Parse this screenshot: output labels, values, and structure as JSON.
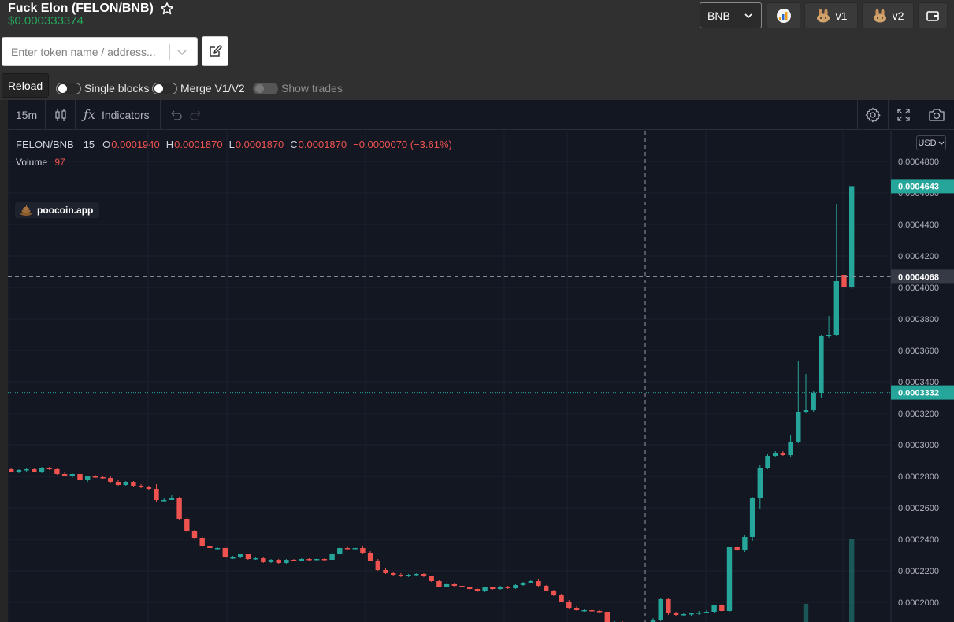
{
  "token": {
    "title": "Fuck Elon (FELON/BNB)",
    "price": "$0.000333374"
  },
  "search": {
    "placeholder": "Enter token name / address..."
  },
  "header": {
    "network": "BNB",
    "v1_label": "v1",
    "v2_label": "v2"
  },
  "controls": {
    "reload": "Reload",
    "single_blocks": "Single blocks",
    "merge": "Merge V1/V2",
    "show_trades": "Show trades"
  },
  "toolbar": {
    "interval": "15m",
    "indicators": "Indicators"
  },
  "legend": {
    "symbol": "FELON/BNB",
    "interval": "15",
    "o_label": "O",
    "o": "0.0001940",
    "h_label": "H",
    "h": "0.0001870",
    "l_label": "L",
    "l": "0.0001870",
    "c_label": "C",
    "c": "0.0001870",
    "change": "−0.0000070 (−3.61%)",
    "volume_label": "Volume",
    "volume": "97"
  },
  "watermark": "poocoin.app",
  "currency": "USD",
  "colors": {
    "up": "#26a69a",
    "down": "#ef5350",
    "bg": "#131722",
    "price_green": "#26a65b"
  },
  "chart_data": {
    "type": "candlestick",
    "y_ticks": [
      "0.0004800",
      "0.0004600",
      "0.0004400",
      "0.0004200",
      "0.0004000",
      "0.0003800",
      "0.0003600",
      "0.0003400",
      "0.0003200",
      "0.0003000",
      "0.0002800",
      "0.0002600",
      "0.0002400",
      "0.0002200",
      "0.0002000"
    ],
    "price_labels": {
      "last": "0.0004643",
      "crosshair": "0.0004068",
      "current": "0.0003332"
    },
    "candles": [
      [
        0.0002845,
        0.0002855,
        0.000283,
        0.000283
      ],
      [
        0.000283,
        0.0002845,
        0.000282,
        0.000284
      ],
      [
        0.000284,
        0.000285,
        0.000283,
        0.0002845
      ],
      [
        0.0002845,
        0.000285,
        0.0002825,
        0.0002825
      ],
      [
        0.0002825,
        0.000286,
        0.000282,
        0.0002855
      ],
      [
        0.0002855,
        0.000286,
        0.000284,
        0.0002845
      ],
      [
        0.0002845,
        0.000285,
        0.000281,
        0.0002815
      ],
      [
        0.0002815,
        0.000283,
        0.00028,
        0.00028
      ],
      [
        0.00028,
        0.000282,
        0.000279,
        0.0002815
      ],
      [
        0.0002815,
        0.0002825,
        0.000277,
        0.0002775
      ],
      [
        0.0002775,
        0.0002805,
        0.0002765,
        0.00028
      ],
      [
        0.00028,
        0.000281,
        0.000279,
        0.0002795
      ],
      [
        0.0002795,
        0.00028,
        0.000278,
        0.000279
      ],
      [
        0.000279,
        0.00028,
        0.000276,
        0.0002765
      ],
      [
        0.0002765,
        0.0002775,
        0.000274,
        0.0002745
      ],
      [
        0.0002745,
        0.000277,
        0.000274,
        0.0002765
      ],
      [
        0.0002765,
        0.000277,
        0.0002735,
        0.000274
      ],
      [
        0.000274,
        0.000275,
        0.0002725,
        0.000273
      ],
      [
        0.000273,
        0.000274,
        0.0002715,
        0.000272
      ],
      [
        0.000272,
        0.000275,
        0.000264,
        0.000265
      ],
      [
        0.000265,
        0.0002665,
        0.0002635,
        0.000265
      ],
      [
        0.000265,
        0.000268,
        0.000265,
        0.0002665
      ],
      [
        0.0002665,
        0.000267,
        0.000252,
        0.000253
      ],
      [
        0.000253,
        0.000254,
        0.000244,
        0.000245
      ],
      [
        0.000245,
        0.000246,
        0.0002405,
        0.000241
      ],
      [
        0.000241,
        0.000242,
        0.000235,
        0.0002355
      ],
      [
        0.0002355,
        0.0002365,
        0.000234,
        0.0002345
      ],
      [
        0.0002345,
        0.000235,
        0.0002335,
        0.0002345
      ],
      [
        0.0002345,
        0.000235,
        0.000228,
        0.0002285
      ],
      [
        0.0002285,
        0.0002295,
        0.0002275,
        0.0002285
      ],
      [
        0.0002285,
        0.000231,
        0.000228,
        0.0002305
      ],
      [
        0.0002305,
        0.000231,
        0.000227,
        0.0002275
      ],
      [
        0.0002275,
        0.000229,
        0.000227,
        0.000228
      ],
      [
        0.000228,
        0.0002285,
        0.000225,
        0.0002255
      ],
      [
        0.0002255,
        0.0002275,
        0.000225,
        0.000227
      ],
      [
        0.000227,
        0.0002275,
        0.0002245,
        0.000225
      ],
      [
        0.000225,
        0.0002275,
        0.0002245,
        0.000227
      ],
      [
        0.000227,
        0.0002275,
        0.000226,
        0.0002265
      ],
      [
        0.0002265,
        0.000228,
        0.000226,
        0.0002275
      ],
      [
        0.0002275,
        0.000228,
        0.0002265,
        0.000227
      ],
      [
        0.000227,
        0.000228,
        0.000226,
        0.0002275
      ],
      [
        0.0002275,
        0.000228,
        0.0002265,
        0.000227
      ],
      [
        0.000227,
        0.000232,
        0.0002265,
        0.000231
      ],
      [
        0.000231,
        0.000235,
        0.00023,
        0.0002345
      ],
      [
        0.0002345,
        0.0002355,
        0.0002335,
        0.000234
      ],
      [
        0.000234,
        0.000235,
        0.000233,
        0.0002345
      ],
      [
        0.0002345,
        0.0002355,
        0.000231,
        0.0002315
      ],
      [
        0.0002315,
        0.0002325,
        0.000226,
        0.0002265
      ],
      [
        0.0002265,
        0.0002275,
        0.00022,
        0.0002205
      ],
      [
        0.0002205,
        0.0002215,
        0.000218,
        0.0002185
      ],
      [
        0.0002185,
        0.0002195,
        0.000217,
        0.0002175
      ],
      [
        0.0002175,
        0.0002185,
        0.000216,
        0.000217
      ],
      [
        0.000217,
        0.000218,
        0.000216,
        0.0002175
      ],
      [
        0.0002175,
        0.0002185,
        0.0002165,
        0.000218
      ],
      [
        0.000218,
        0.0002185,
        0.000216,
        0.0002165
      ],
      [
        0.0002165,
        0.000217,
        0.000213,
        0.0002135
      ],
      [
        0.0002135,
        0.000214,
        0.0002095,
        0.00021
      ],
      [
        0.00021,
        0.000212,
        0.0002095,
        0.0002115
      ],
      [
        0.0002115,
        0.000212,
        0.00021,
        0.0002105
      ],
      [
        0.0002105,
        0.000211,
        0.000209,
        0.0002095
      ],
      [
        0.0002095,
        0.00021,
        0.000208,
        0.0002085
      ],
      [
        0.0002085,
        0.000209,
        0.0002065,
        0.000207
      ],
      [
        0.000207,
        0.00021,
        0.0002065,
        0.0002095
      ],
      [
        0.0002095,
        0.00021,
        0.000208,
        0.0002085
      ],
      [
        0.0002085,
        0.0002105,
        0.000208,
        0.00021
      ],
      [
        0.00021,
        0.0002105,
        0.0002085,
        0.000209
      ],
      [
        0.000209,
        0.0002115,
        0.0002085,
        0.000211
      ],
      [
        0.000211,
        0.000213,
        0.0002105,
        0.0002125
      ],
      [
        0.0002125,
        0.000214,
        0.000212,
        0.0002135
      ],
      [
        0.0002135,
        0.0002145,
        0.00021,
        0.0002105
      ],
      [
        0.0002105,
        0.000211,
        0.000207,
        0.0002075
      ],
      [
        0.0002075,
        0.000208,
        0.000204,
        0.0002045
      ],
      [
        0.0002045,
        0.000205,
        0.0002,
        0.0002005
      ],
      [
        0.0002005,
        0.0002015,
        0.000196,
        0.0001965
      ],
      [
        0.0001965,
        0.0001975,
        0.0001945,
        0.000195
      ],
      [
        0.000195,
        0.000196,
        0.000194,
        0.000195
      ],
      [
        0.000195,
        0.0001955,
        0.000194,
        0.0001945
      ],
      [
        0.0001945,
        0.000195,
        0.0001935,
        0.000194
      ],
      [
        0.000194,
        0.000194,
        0.000187,
        0.000187
      ],
      [
        0.000187,
        0.000188,
        0.000186,
        0.0001875
      ],
      [
        0.0001875,
        0.000188,
        0.0001855,
        0.000186
      ],
      [
        0.000186,
        0.000187,
        0.000185,
        0.0001865
      ],
      [
        0.0001865,
        0.000187,
        0.0001845,
        0.000185
      ],
      [
        0.000185,
        0.000186,
        0.000184,
        0.0001855
      ],
      [
        0.0001855,
        0.00019,
        0.000185,
        0.000189
      ],
      [
        0.000189,
        0.000203,
        0.000188,
        0.000202
      ],
      [
        0.000202,
        0.000203,
        0.000192,
        0.000193
      ],
      [
        0.000193,
        0.000194,
        0.000191,
        0.000192
      ],
      [
        0.000192,
        0.0001935,
        0.000191,
        0.0001925
      ],
      [
        0.0001925,
        0.0001935,
        0.0001915,
        0.000193
      ],
      [
        0.000193,
        0.0001945,
        0.000192,
        0.0001935
      ],
      [
        0.0001935,
        0.000195,
        0.000193,
        0.000194
      ],
      [
        0.000194,
        0.0001985,
        0.0001935,
        0.000198
      ],
      [
        0.000198,
        0.000199,
        0.000194,
        0.0001945
      ],
      [
        0.0001945,
        0.000235,
        0.000194,
        0.000235
      ],
      [
        0.000235,
        0.0002355,
        0.0002325,
        0.000233
      ],
      [
        0.000233,
        0.0002425,
        0.000232,
        0.0002415
      ],
      [
        0.0002415,
        0.000267,
        0.000239,
        0.000266
      ],
      [
        0.000266,
        0.000287,
        0.000259,
        0.0002855
      ],
      [
        0.0002855,
        0.000294,
        0.0002845,
        0.000293
      ],
      [
        0.000293,
        0.000296,
        0.000292,
        0.000295
      ],
      [
        0.000295,
        0.000296,
        0.000293,
        0.0002935
      ],
      [
        0.0002935,
        0.000306,
        0.0002925,
        0.000302
      ],
      [
        0.000302,
        0.000353,
        0.000301,
        0.000321
      ],
      [
        0.000321,
        0.000345,
        0.00032,
        0.000322
      ],
      [
        0.000322,
        0.000334,
        0.000321,
        0.000333
      ],
      [
        0.000333,
        0.00037,
        0.00033,
        0.000369
      ],
      [
        0.000369,
        0.000382,
        0.000368,
        0.00037
      ],
      [
        0.00037,
        0.000453,
        0.000369,
        0.000404
      ],
      [
        0.000408,
        0.000412,
        0.000399,
        0.0004
      ],
      [
        0.0004,
        0.0004643,
        0.000399,
        0.0004643
      ]
    ],
    "volume_bars": [
      {
        "index": 104,
        "volume": 0.22,
        "up": true
      },
      {
        "index": 110,
        "volume": 1.0,
        "up": true
      }
    ]
  }
}
